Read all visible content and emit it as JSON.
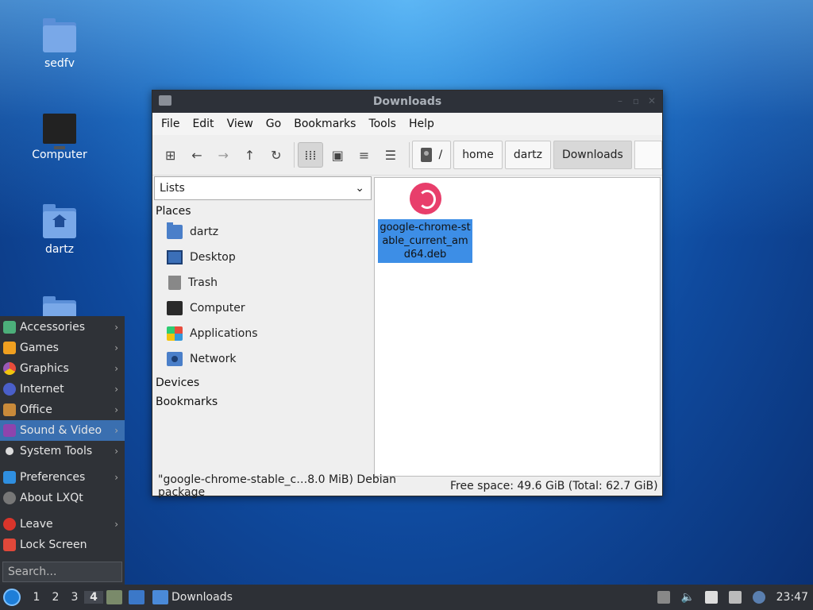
{
  "desktop": {
    "icons": [
      {
        "label": "sedfv"
      },
      {
        "label": "Computer"
      },
      {
        "label": "dartz"
      }
    ]
  },
  "window": {
    "title": "Downloads",
    "menu": [
      "File",
      "Edit",
      "View",
      "Go",
      "Bookmarks",
      "Tools",
      "Help"
    ],
    "breadcrumbs": [
      "/",
      "home",
      "dartz",
      "Downloads"
    ],
    "sidebar": {
      "dropdown_value": "Lists",
      "places_header": "Places",
      "places": [
        "dartz",
        "Desktop",
        "Trash",
        "Computer",
        "Applications",
        "Network"
      ],
      "devices_header": "Devices",
      "bookmarks_header": "Bookmarks"
    },
    "file": {
      "name": "google-chrome-stable_current_amd64.deb",
      "name_display": "google-chrome-stable_current_amd64.deb"
    },
    "status": {
      "selection": "\"google-chrome-stable_c…8.0 MiB) Debian package",
      "free_space": "Free space: 49.6 GiB (Total: 62.7 GiB)"
    }
  },
  "start_menu": {
    "items": [
      "Accessories",
      "Games",
      "Graphics",
      "Internet",
      "Office",
      "Sound & Video",
      "System Tools"
    ],
    "items2": [
      "Preferences",
      "About LXQt"
    ],
    "items3": [
      "Leave",
      "Lock Screen"
    ],
    "highlighted": "Sound & Video",
    "search_placeholder": "Search..."
  },
  "taskbar": {
    "workspaces": [
      "1",
      "2",
      "3",
      "4"
    ],
    "active_workspace": "4",
    "task_label": "Downloads",
    "clock": "23:47"
  },
  "colors": {
    "accent": "#3d8ee6",
    "menu_highlight": "#3a6fb0",
    "panel": "#2d3036"
  }
}
